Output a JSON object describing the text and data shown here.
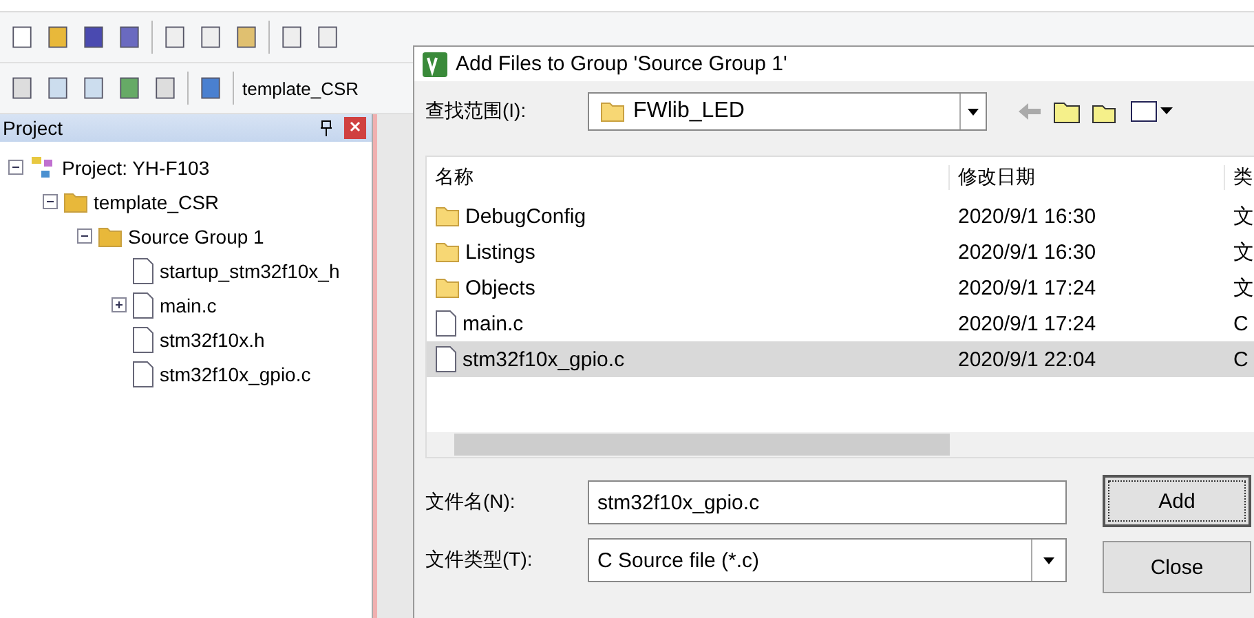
{
  "toolbar_target": {
    "value": "template_CSR"
  },
  "project_panel": {
    "title": "Project",
    "tree": [
      {
        "kind": "project",
        "label": "Project: YH-F103",
        "expanded": true,
        "children": [
          {
            "kind": "target",
            "label": "template_CSR",
            "expanded": true,
            "children": [
              {
                "kind": "group",
                "label": "Source Group 1",
                "expanded": true,
                "children": [
                  {
                    "kind": "file",
                    "label": "startup_stm32f10x_h"
                  },
                  {
                    "kind": "file",
                    "label": "main.c",
                    "expanded": false
                  },
                  {
                    "kind": "file",
                    "label": "stm32f10x.h"
                  },
                  {
                    "kind": "file",
                    "label": "stm32f10x_gpio.c"
                  }
                ]
              }
            ]
          }
        ]
      }
    ]
  },
  "dialog": {
    "title": "Add Files to Group 'Source Group 1'",
    "look_in": {
      "label": "查找范围(I):",
      "value": "FWlib_LED"
    },
    "columns": [
      "名称",
      "修改日期",
      "类"
    ],
    "rows": [
      {
        "kind": "folder",
        "name": "DebugConfig",
        "date": "2020/9/1 16:30",
        "type": "文",
        "selected": false
      },
      {
        "kind": "folder",
        "name": "Listings",
        "date": "2020/9/1 16:30",
        "type": "文",
        "selected": false
      },
      {
        "kind": "folder",
        "name": "Objects",
        "date": "2020/9/1 17:24",
        "type": "文",
        "selected": false
      },
      {
        "kind": "file",
        "name": "main.c",
        "date": "2020/9/1 17:24",
        "type": "C",
        "selected": false
      },
      {
        "kind": "file",
        "name": "stm32f10x_gpio.c",
        "date": "2020/9/1 22:04",
        "type": "C",
        "selected": true
      }
    ],
    "file_name": {
      "label": "文件名(N):",
      "value": "stm32f10x_gpio.c"
    },
    "file_type": {
      "label": "文件类型(T):",
      "value": "C Source file (*.c)"
    },
    "buttons": [
      "Add",
      "Close"
    ]
  }
}
